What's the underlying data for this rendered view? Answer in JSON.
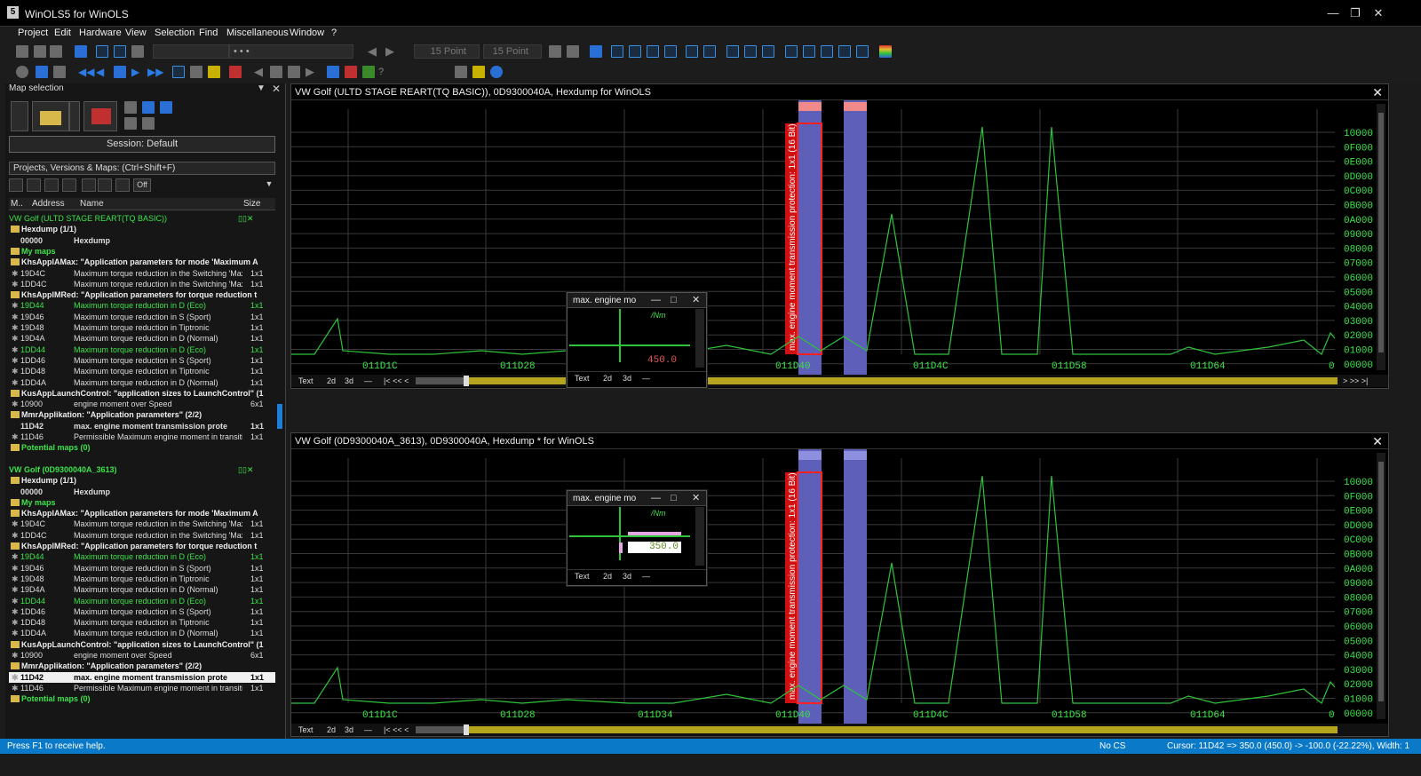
{
  "window": {
    "title": "WinOLS5 for WinOLS",
    "logo": "5"
  },
  "menu": [
    "Project",
    "Edit",
    "Hardware",
    "View",
    "Selection",
    "Find",
    "Miscellaneous",
    "Window",
    "?"
  ],
  "toolbar": {
    "font_size_1": "15 Point",
    "font_size_2": "15 Point",
    "dots": "• • •"
  },
  "left": {
    "header": "Map selection",
    "session": "Session: Default",
    "select": "Projects, Versions & Maps:  (Ctrl+Shift+F)",
    "filter_off": "Off",
    "columns": {
      "m": "M..",
      "address": "Address",
      "name": "Name",
      "size": "Size"
    }
  },
  "tree": [
    {
      "t": "proj",
      "a": "VW Golf (ULTD STAGE REART(TQ BASIC))",
      "b": "",
      "c": ""
    },
    {
      "t": "folder",
      "a": "Hexdump (1/1)",
      "b": "",
      "c": ""
    },
    {
      "t": "bold",
      "a": "00000",
      "b": "Hexdump",
      "c": ""
    },
    {
      "t": "folder-green",
      "a": "My maps",
      "b": "",
      "c": ""
    },
    {
      "t": "folder",
      "a": "KhsApplAMax: \"Application parameters for mode 'Maximum A",
      "b": "",
      "c": ""
    },
    {
      "t": "item",
      "a": "19D4C",
      "b": "Maximum torque reduction in the Switching 'Max",
      "c": "1x1"
    },
    {
      "t": "item",
      "a": "1DD4C",
      "b": "Maximum torque reduction in the Switching 'Max",
      "c": "1x1"
    },
    {
      "t": "folder",
      "a": "KhsApplMRed: \"Application parameters for torque reduction t",
      "b": "",
      "c": ""
    },
    {
      "t": "green",
      "a": "19D44",
      "b": "Maximum torque reduction in D (Eco)",
      "c": "1x1"
    },
    {
      "t": "item",
      "a": "19D46",
      "b": "Maximum torque reduction in S (Sport)",
      "c": "1x1"
    },
    {
      "t": "item",
      "a": "19D48",
      "b": "Maximum torque reduction in Tiptronic",
      "c": "1x1"
    },
    {
      "t": "item",
      "a": "19D4A",
      "b": "Maximum torque reduction in D (Normal)",
      "c": "1x1"
    },
    {
      "t": "green",
      "a": "1DD44",
      "b": "Maximum torque reduction in D (Eco)",
      "c": "1x1"
    },
    {
      "t": "item",
      "a": "1DD46",
      "b": "Maximum torque reduction in S (Sport)",
      "c": "1x1"
    },
    {
      "t": "item",
      "a": "1DD48",
      "b": "Maximum torque reduction in Tiptronic",
      "c": "1x1"
    },
    {
      "t": "item",
      "a": "1DD4A",
      "b": "Maximum torque reduction in D (Normal)",
      "c": "1x1"
    },
    {
      "t": "folder",
      "a": "KusAppLaunchControl: \"application sizes to LaunchControl\" (1",
      "b": "",
      "c": ""
    },
    {
      "t": "item",
      "a": "10900",
      "b": "engine moment over Speed",
      "c": "6x1"
    },
    {
      "t": "folder",
      "a": "MmrApplikation: \"Application parameters\" (2/2)",
      "b": "",
      "c": ""
    },
    {
      "t": "bold",
      "a": "11D42",
      "b": "max. engine moment transmission prote",
      "c": "1x1"
    },
    {
      "t": "item",
      "a": "11D46",
      "b": "Permissible Maximum engine moment in transitio",
      "c": "1x1"
    },
    {
      "t": "folder-green",
      "a": "Potential maps (0)",
      "b": "",
      "c": ""
    },
    {
      "t": "blank",
      "a": "",
      "b": "",
      "c": ""
    },
    {
      "t": "proj",
      "a": "VW Golf (0D9300040A_3613)",
      "b": "",
      "c": ""
    },
    {
      "t": "folder",
      "a": "Hexdump (1/1)",
      "b": "",
      "c": ""
    },
    {
      "t": "bold",
      "a": "00000",
      "b": "Hexdump",
      "c": ""
    },
    {
      "t": "folder-green",
      "a": "My maps",
      "b": "",
      "c": ""
    },
    {
      "t": "folder",
      "a": "KhsApplAMax: \"Application parameters for mode 'Maximum A",
      "b": "",
      "c": ""
    },
    {
      "t": "item",
      "a": "19D4C",
      "b": "Maximum torque reduction in the Switching 'Max",
      "c": "1x1"
    },
    {
      "t": "item",
      "a": "1DD4C",
      "b": "Maximum torque reduction in the Switching 'Max",
      "c": "1x1"
    },
    {
      "t": "folder",
      "a": "KhsApplMRed: \"Application parameters for torque reduction t",
      "b": "",
      "c": ""
    },
    {
      "t": "green",
      "a": "19D44",
      "b": "Maximum torque reduction in D (Eco)",
      "c": "1x1"
    },
    {
      "t": "item",
      "a": "19D46",
      "b": "Maximum torque reduction in S (Sport)",
      "c": "1x1"
    },
    {
      "t": "item",
      "a": "19D48",
      "b": "Maximum torque reduction in Tiptronic",
      "c": "1x1"
    },
    {
      "t": "item",
      "a": "19D4A",
      "b": "Maximum torque reduction in D (Normal)",
      "c": "1x1"
    },
    {
      "t": "green",
      "a": "1DD44",
      "b": "Maximum torque reduction in D (Eco)",
      "c": "1x1"
    },
    {
      "t": "item",
      "a": "1DD46",
      "b": "Maximum torque reduction in S (Sport)",
      "c": "1x1"
    },
    {
      "t": "item",
      "a": "1DD48",
      "b": "Maximum torque reduction in Tiptronic",
      "c": "1x1"
    },
    {
      "t": "item",
      "a": "1DD4A",
      "b": "Maximum torque reduction in D (Normal)",
      "c": "1x1"
    },
    {
      "t": "folder",
      "a": "KusAppLaunchControl: \"application sizes to LaunchControl\" (1",
      "b": "",
      "c": ""
    },
    {
      "t": "item",
      "a": "10900",
      "b": "engine moment over Speed",
      "c": "6x1"
    },
    {
      "t": "folder",
      "a": "MmrApplikation: \"Application parameters\" (2/2)",
      "b": "",
      "c": ""
    },
    {
      "t": "sel",
      "a": "11D42",
      "b": "max. engine moment transmission prote",
      "c": "1x1"
    },
    {
      "t": "item",
      "a": "11D46",
      "b": "Permissible Maximum engine moment in transitio",
      "c": "1x1"
    },
    {
      "t": "folder-green",
      "a": "Potential maps (0)",
      "b": "",
      "c": ""
    }
  ],
  "doc1": {
    "title": "VW Golf (ULTD STAGE REART(TQ BASIC)), 0D9300040A, Hexdump for WinOLS",
    "xlabels": [
      "011D1C",
      "011D28",
      "011D40",
      "011D4C",
      "011D58",
      "011D64",
      "0"
    ],
    "marker": "max. engine moment transmission protection: 1x1 (16 Bit)",
    "popup": {
      "title": "max. engine mo",
      "unit": "/Nm",
      "value": "450.0"
    }
  },
  "doc2": {
    "title": "VW Golf (0D9300040A_3613), 0D9300040A, Hexdump * for WinOLS",
    "xlabels": [
      "011D1C",
      "011D28",
      "011D34",
      "011D40",
      "011D4C",
      "011D58",
      "011D64",
      "0"
    ],
    "marker": "max. engine moment transmission protection: 1x1 (16 Bit)",
    "popup": {
      "title": "max. engine mo",
      "unit": "/Nm",
      "value": "350.0"
    }
  },
  "yaxis": [
    "10000",
    "0F000",
    "0E000",
    "0D000",
    "0C000",
    "0B000",
    "0A000",
    "09000",
    "08000",
    "07000",
    "06000",
    "05000",
    "04000",
    "03000",
    "02000",
    "01000",
    "00000"
  ],
  "tabs": {
    "text": "Text",
    "d2": "2d",
    "d3": "3d",
    "dash": "—"
  },
  "status": {
    "help": "Press F1 to receive help.",
    "cs": "No CS",
    "cursor": "Cursor: 11D42 => 350.0 (450.0) -> -100.0 (-22.22%), Width: 1"
  },
  "colors": {
    "line": "#2ec43a",
    "axis_text": "#3de34a",
    "marker": "#d01010",
    "highlight": "#5d5fb8"
  }
}
